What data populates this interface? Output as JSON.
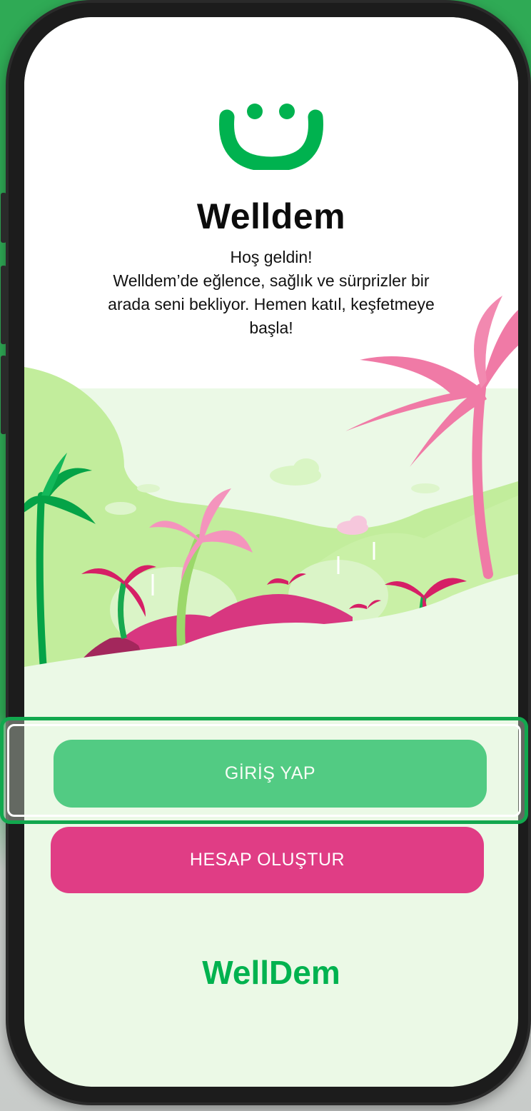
{
  "app": {
    "title": "Welldem",
    "welcome_lines": [
      "Hoş geldin!",
      "Welldem’de eğlence, sağlık ve sürprizler bir",
      "arada seni bekliyor. Hemen katıl, keşfetmeye",
      "başla!"
    ]
  },
  "buttons": {
    "login_label": "GİRİŞ YAP",
    "signup_label": "HESAP OLUŞTUR"
  },
  "footer": {
    "wordmark": "WellDem"
  },
  "icons": {
    "logo": "smile-logo-icon",
    "illustration": "tropical-palm-landscape-illustration"
  },
  "colors": {
    "brand_green": "#00b24f",
    "brand_pink": "#e03d85",
    "screen_background": "#ebf9e6",
    "page_background": "#2faa55"
  }
}
